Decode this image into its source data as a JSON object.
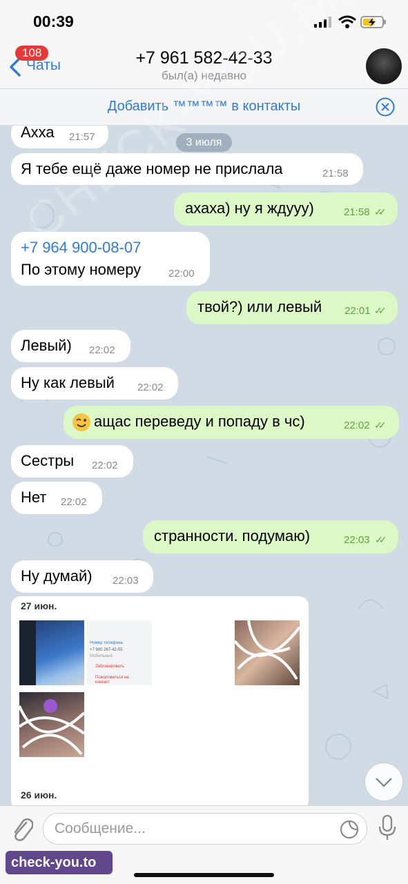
{
  "status_bar": {
    "time": "00:39"
  },
  "header": {
    "back_badge": "108",
    "back_label": "Чаты",
    "title": "+7 961 582-42-33",
    "subtitle": "был(а) недавно"
  },
  "add_contact_bar": {
    "text": "Добавить ™™™™ в контакты"
  },
  "date_pill": "3 июля",
  "messages": [
    {
      "dir": "in",
      "text": "Ахха",
      "time": "21:57"
    },
    {
      "dir": "in",
      "text": "Я тебе ещё даже номер не прислала",
      "time": "21:58"
    },
    {
      "dir": "out",
      "text": "ахаха) ну я  ждууу)",
      "time": "21:58"
    },
    {
      "dir": "in",
      "link": "+7 964 900-08-07",
      "text": "По этому номеру",
      "time": "22:00"
    },
    {
      "dir": "out",
      "text": "твой?) или левый",
      "time": "22:01"
    },
    {
      "dir": "in",
      "text": "Левый)",
      "time": "22:02"
    },
    {
      "dir": "in",
      "text": "Ну как левый",
      "time": "22:02"
    },
    {
      "dir": "out",
      "text": "ащас переведу и попаду в чс)",
      "time": "22:02",
      "emoji": "wink-emoji"
    },
    {
      "dir": "in",
      "text": "Сестры",
      "time": "22:02"
    },
    {
      "dir": "in",
      "text": "Нет",
      "time": "22:02"
    },
    {
      "dir": "out",
      "text": "странности. подумаю)",
      "time": "22:03"
    },
    {
      "dir": "in",
      "text": "Ну думай)",
      "time": "22:03"
    }
  ],
  "media_card": {
    "date1": "27 июн.",
    "date2": "26 июн.",
    "screenshot_thumb": {
      "label_number": "Номер телефона",
      "number": "+7 900 267-42-55",
      "mobile": "Мобильный",
      "block": "Заблокировать",
      "report": "Пожаловаться на",
      "report2": "контакт"
    }
  },
  "input_bar": {
    "placeholder": "Сообщение..."
  },
  "watermark": {
    "badge": "check-you.to",
    "diagonal": "CHECK-YOU.ME"
  },
  "colors": {
    "accent": "#2f7bd9",
    "outgoing": "#dcf8c6",
    "incoming": "#ffffff",
    "badge": "#e53935"
  }
}
